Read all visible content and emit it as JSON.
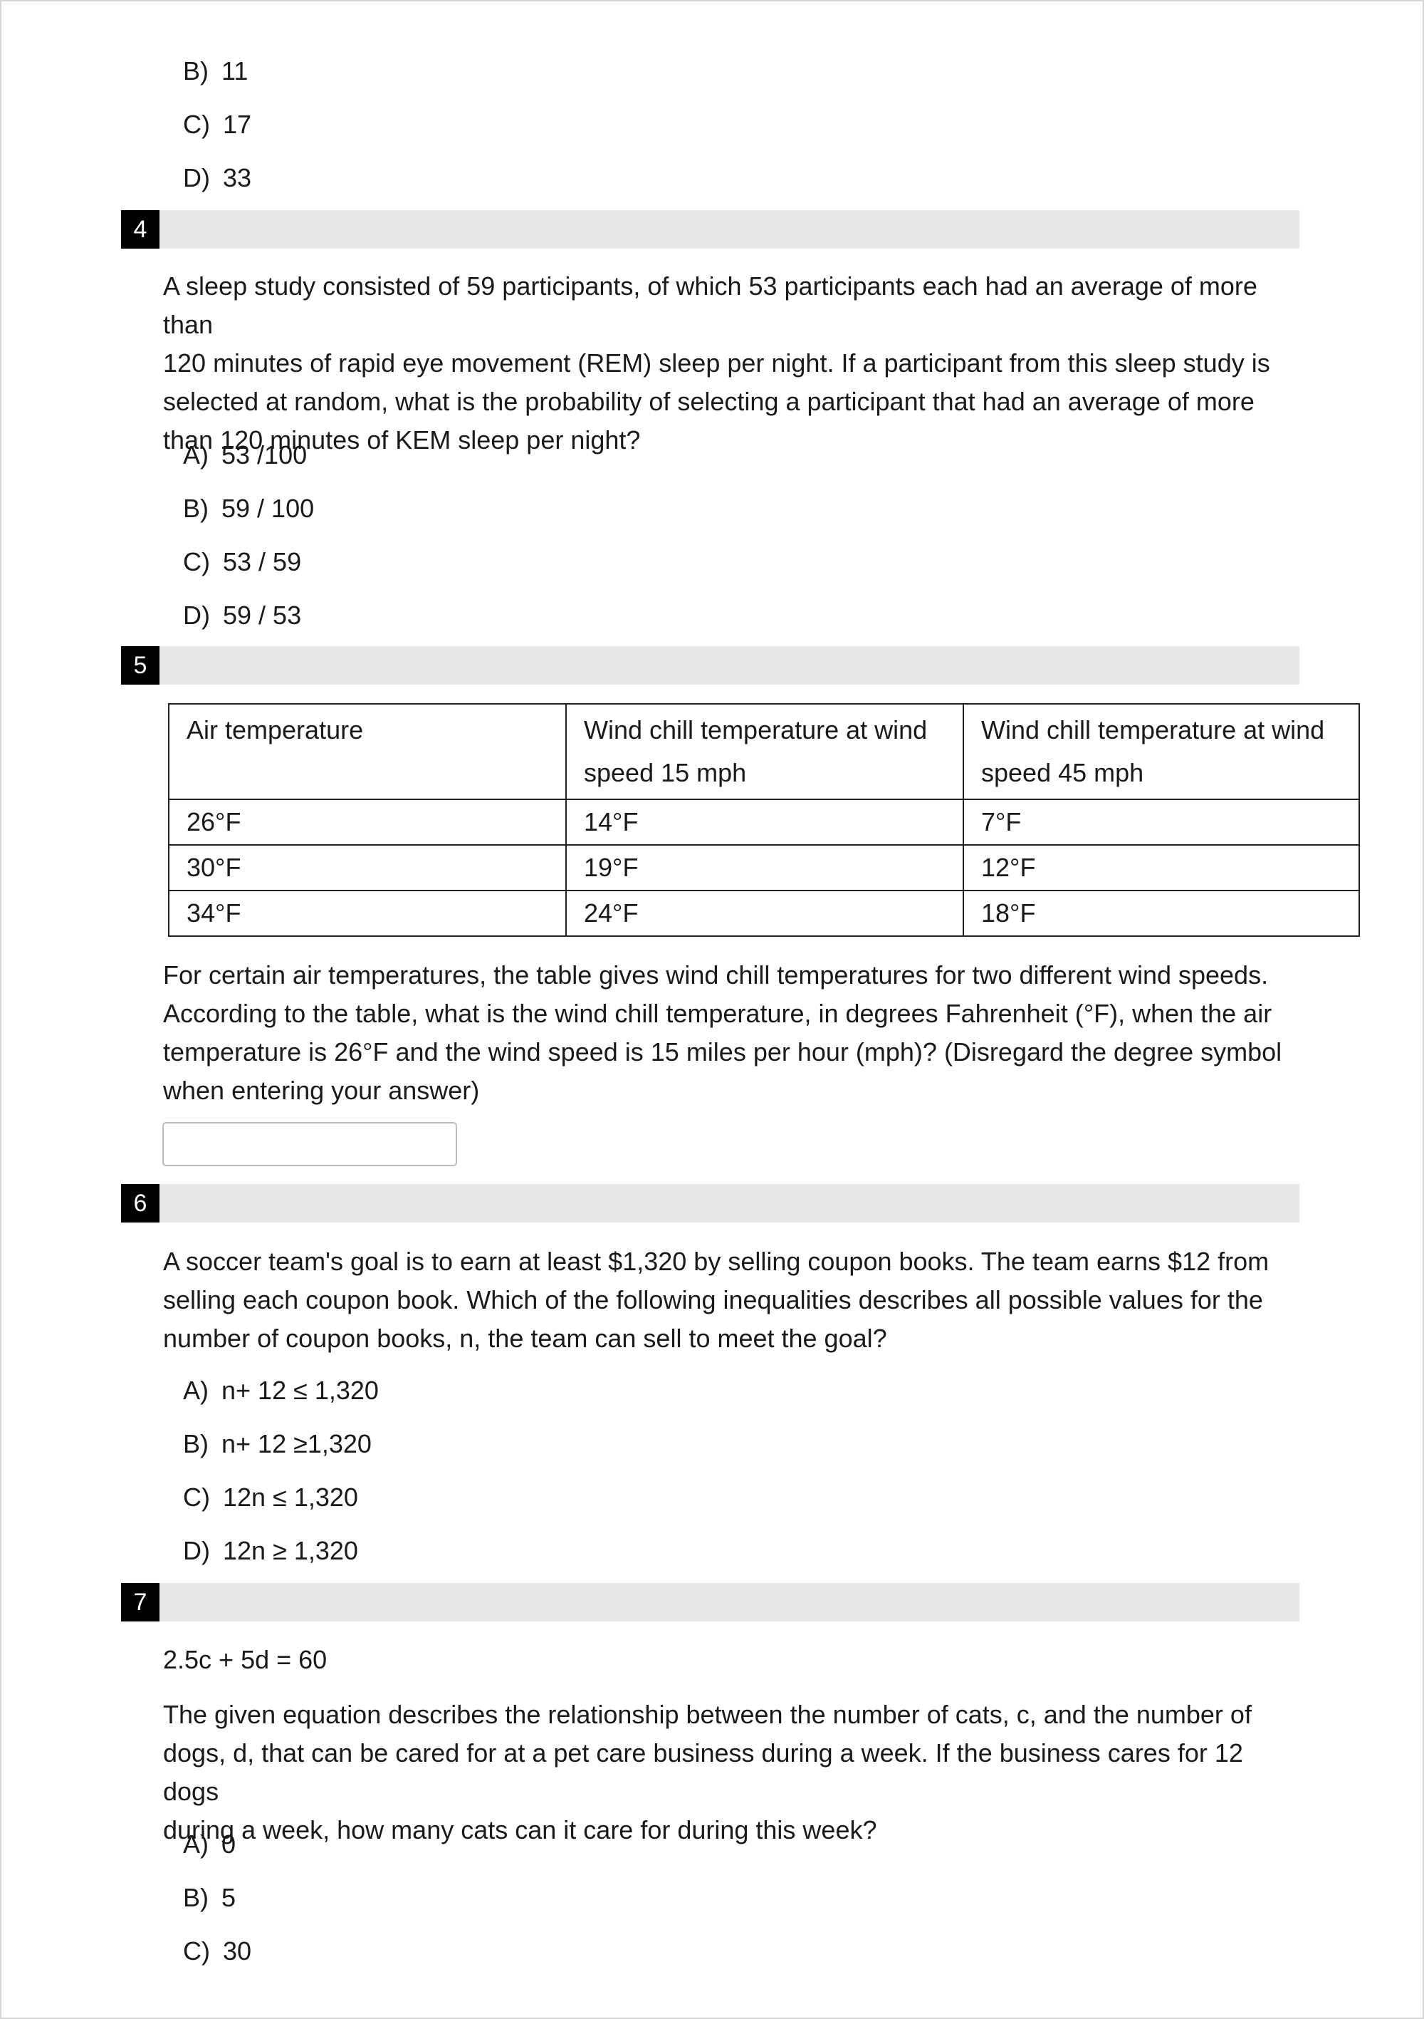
{
  "q3": {
    "choices": [
      {
        "letter": "B)",
        "text": "11"
      },
      {
        "letter": "C)",
        "text": "17"
      },
      {
        "letter": "D)",
        "text": "33"
      }
    ]
  },
  "q4": {
    "number": "4",
    "lines": [
      "A sleep study consisted of 59 participants, of which 53 participants each had an average of more than",
      "120 minutes of rapid eye movement (REM) sleep per night. If a participant from this sleep study is",
      "selected at random, what is the probability of selecting a participant that had an average of more",
      "than 120 minutes of KEM sleep per night?"
    ],
    "choices": [
      {
        "letter": "A)",
        "text": "53 /100"
      },
      {
        "letter": "B)",
        "text": "59 / 100"
      },
      {
        "letter": "C)",
        "text": "53 / 59"
      },
      {
        "letter": "D)",
        "text": "59 / 53"
      }
    ]
  },
  "q5": {
    "number": "5",
    "table": {
      "headers": [
        "Air temperature",
        "Wind chill temperature at wind speed 15 mph",
        "Wind chill temperature at wind speed 45 mph"
      ],
      "rows": [
        [
          "26°F",
          "14°F",
          "7°F"
        ],
        [
          "30°F",
          "19°F",
          "12°F"
        ],
        [
          "34°F",
          "24°F",
          "18°F"
        ]
      ]
    },
    "lines": [
      "For certain air temperatures, the table gives wind chill temperatures for two different wind speeds.",
      "According to the table, what is the wind chill temperature, in degrees Fahrenheit (°F), when the air",
      "temperature is 26°F and the wind speed is 15 miles per hour (mph)? (Disregard the degree symbol",
      "when entering your answer)"
    ],
    "answer_value": ""
  },
  "q6": {
    "number": "6",
    "lines": [
      "A soccer team's goal is to earn at least $1,320 by selling coupon books. The team earns $12 from",
      "selling each coupon book. Which of the following inequalities describes all possible values for the",
      "number of coupon books, n, the team can sell to meet the goal?"
    ],
    "choices": [
      {
        "letter": "A)",
        "text": "n+ 12 ≤ 1,320"
      },
      {
        "letter": "B)",
        "text": "n+ 12 ≥1,320"
      },
      {
        "letter": "C)",
        "text": "12n ≤ 1,320"
      },
      {
        "letter": "D)",
        "text": "12n ≥ 1,320"
      }
    ]
  },
  "q7": {
    "number": "7",
    "equation": "2.5c + 5d = 60",
    "lines": [
      "The given equation describes the relationship between the number of cats, c, and the number of",
      "dogs, d, that can be cared for at a pet care business during a week. If the business cares for 12 dogs",
      "during a week, how many cats can it care for during this week?"
    ],
    "choices": [
      {
        "letter": "A)",
        "text": "0"
      },
      {
        "letter": "B)",
        "text": "5"
      },
      {
        "letter": "C)",
        "text": "30"
      }
    ]
  }
}
